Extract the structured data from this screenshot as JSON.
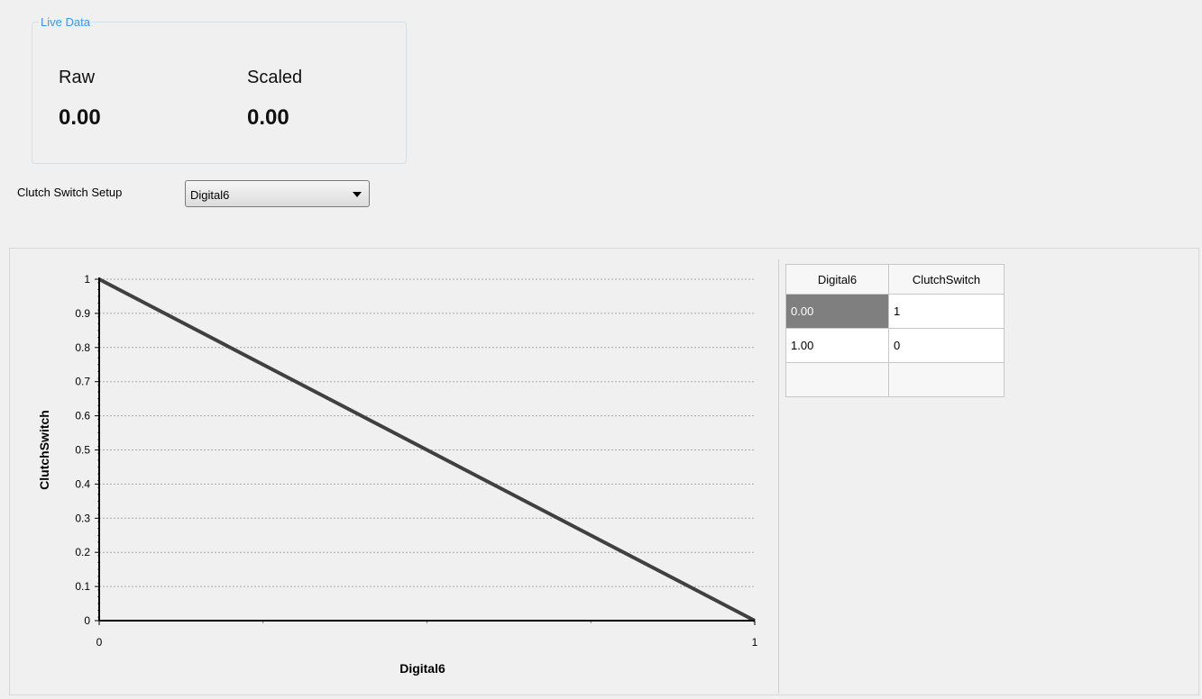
{
  "live_data": {
    "title": "Live Data",
    "raw_label": "Raw",
    "raw_value": "0.00",
    "scaled_label": "Scaled",
    "scaled_value": "0.00"
  },
  "setup": {
    "label": "Clutch Switch Setup",
    "selected": "Digital6"
  },
  "chart_data": {
    "type": "line",
    "xlabel": "Digital6",
    "ylabel": "ClutchSwitch",
    "xlim": [
      0,
      1
    ],
    "ylim": [
      0,
      1
    ],
    "x_ticks": [
      "0",
      "1"
    ],
    "y_ticks": [
      "0",
      "0.1",
      "0.2",
      "0.3",
      "0.4",
      "0.5",
      "0.6",
      "0.7",
      "0.8",
      "0.9",
      "1"
    ],
    "grid": true,
    "series": [
      {
        "x": [
          0,
          1
        ],
        "y": [
          1,
          0
        ],
        "color": "#404040"
      }
    ]
  },
  "table": {
    "columns": [
      "Digital6",
      "ClutchSwitch"
    ],
    "rows": [
      [
        "0.00",
        "1"
      ],
      [
        "1.00",
        "0"
      ],
      [
        "",
        ""
      ]
    ]
  }
}
